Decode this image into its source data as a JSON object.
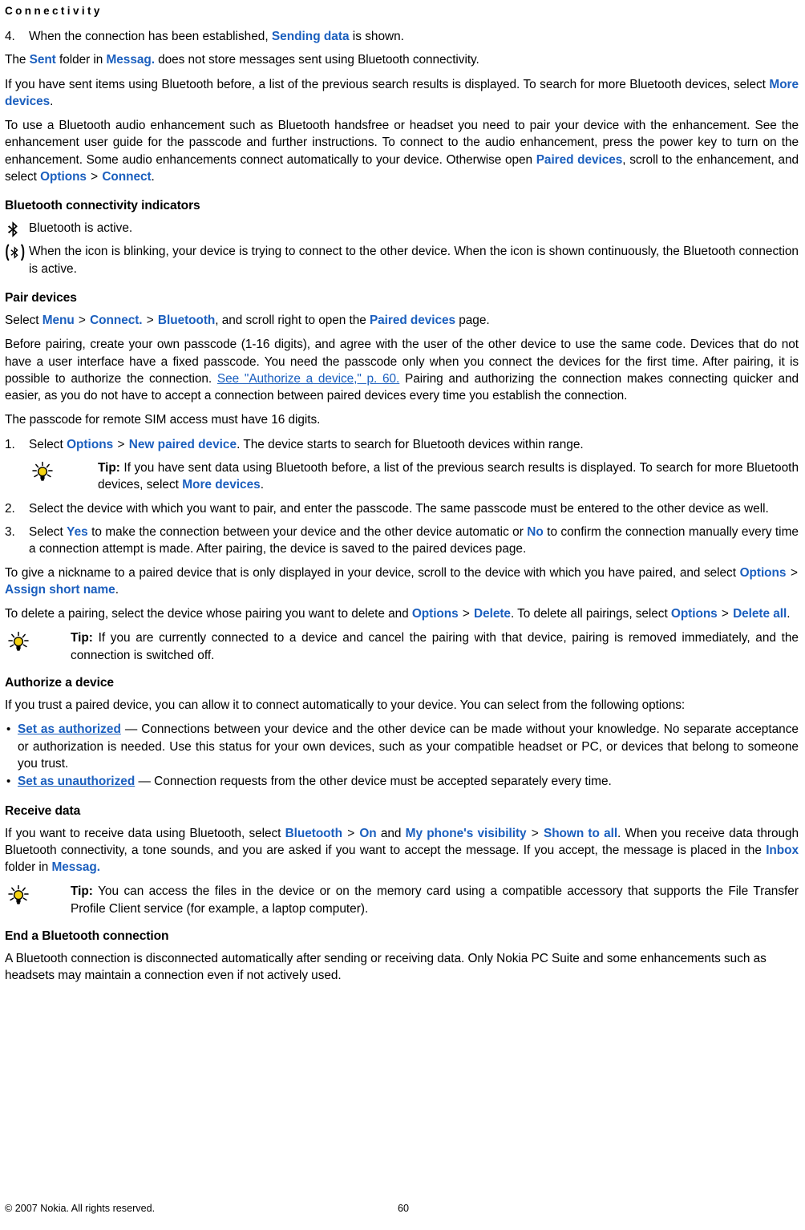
{
  "document": {
    "running_header": "Connectivity",
    "page_number": "60",
    "copyright": "© 2007 Nokia. All rights reserved."
  },
  "colors": {
    "link_blue": "#1B5FBE",
    "text_black": "#000000",
    "bulb_yellow": "#F5D312",
    "page_background": "#FFFFFF"
  },
  "intro": {
    "step4": {
      "number": "4.",
      "before": "When the connection has been established, ",
      "ui_1": "Sending data",
      "after": " is shown."
    },
    "sent_folder": {
      "before": "The ",
      "ui_1": "Sent",
      "mid_1": " folder in ",
      "ui_2": "Messag.",
      "after": " does not store messages sent using Bluetooth connectivity."
    },
    "sent_items": {
      "before": "If you have sent items using Bluetooth before, a list of the previous search results is displayed. To search for more Bluetooth devices, select ",
      "ui_1": "More devices",
      "after": "."
    },
    "audio_enhancement": {
      "before": "To use a Bluetooth audio enhancement such as Bluetooth handsfree or headset you need to pair your device with the enhancement. See the enhancement user guide for the passcode and further instructions. To connect to the audio enhancement, press the power key to turn on the enhancement. Some audio enhancements connect automatically to your device. Otherwise open ",
      "ui_1": "Paired devices",
      "mid_1": ", scroll to the enhancement, and select ",
      "ui_2": "Options",
      "sep_1": " > ",
      "ui_3": "Connect",
      "after": "."
    }
  },
  "indicators": {
    "heading": "Bluetooth connectivity indicators",
    "items": [
      {
        "icon": "bluetooth-icon",
        "text": "Bluetooth is active."
      },
      {
        "icon": "bluetooth-connected-icon",
        "text": "When the icon is blinking, your device is trying to connect to the other device. When the icon is shown continuously, the Bluetooth connection is active."
      }
    ]
  },
  "pair_devices": {
    "heading": "Pair devices",
    "select_path": {
      "before": "Select ",
      "ui_1": "Menu",
      "sep_1": " > ",
      "ui_2": "Connect.",
      "sep_2": " > ",
      "ui_3": "Bluetooth",
      "mid_1": ", and scroll right to open the ",
      "ui_4": "Paired devices",
      "after": " page."
    },
    "before_pairing": {
      "before": "Before pairing, create your own passcode (1-16 digits), and agree with the user of the other device to use the same code. Devices that do not have a user interface have a fixed passcode. You need the passcode only when you connect the devices for the first time. After pairing, it is possible to authorize the connection. ",
      "xref": "See \"Authorize a device,\" p. 60.",
      "after": " Pairing and authorizing the connection makes connecting quicker and easier, as you do not have to accept a connection between paired devices every time you establish the connection."
    },
    "remote_sim": "The passcode for remote SIM access must have 16 digits.",
    "steps": [
      {
        "number": "1.",
        "before": "Select ",
        "ui_1": "Options",
        "sep_1": " > ",
        "ui_2": "New paired device",
        "after": ". The device starts to search for Bluetooth devices within range."
      },
      {
        "number": "2.",
        "before": "Select the device with which you want to pair, and enter the passcode. The same passcode must be entered to the other device as well.",
        "ui_1": "",
        "after": ""
      },
      {
        "number": "3.",
        "before": "Select ",
        "ui_1": "Yes",
        "mid_1": " to make the connection between your device and the other device automatic or ",
        "ui_2": "No",
        "after": " to confirm the connection manually every time a connection attempt is made. After pairing, the device is saved to the paired devices page."
      }
    ],
    "tip_search": {
      "label": "Tip:",
      "before": " If you have sent data using Bluetooth before, a list of the previous search results is displayed. To search for more Bluetooth devices, select ",
      "ui_1": "More devices",
      "after": "."
    },
    "nickname": {
      "before": "To give a nickname to a paired device that is only displayed in your device, scroll to the device with which you have paired, and select ",
      "ui_1": "Options",
      "sep_1": " > ",
      "ui_2": "Assign short name",
      "after": "."
    },
    "delete_pairing": {
      "before": "To delete a pairing, select the device whose pairing you want to delete and ",
      "ui_1": "Options",
      "sep_1": " > ",
      "ui_2": "Delete",
      "mid_1": ". To delete all pairings, select ",
      "ui_3": "Options",
      "sep_2": " > ",
      "ui_4": "Delete all",
      "after": "."
    },
    "tip_cancel": {
      "label": "Tip:",
      "text": " If you are currently connected to a device and cancel the pairing with that device, pairing is removed immediately, and the connection is switched off."
    }
  },
  "authorize_device": {
    "heading": "Authorize a device",
    "intro": "If you trust a paired device, you can allow it to connect automatically to your device. You can select from the following options:",
    "bullet_char": "•",
    "options": [
      {
        "ui_1": "Set as authorized",
        "after": " — Connections between your device and the other device can be made without your knowledge. No separate acceptance or authorization is needed. Use this status for your own devices, such as your compatible headset or PC, or devices that belong to someone you trust."
      },
      {
        "ui_1": "Set as unauthorized",
        "after": " — Connection requests from the other device must be accepted separately every time."
      }
    ]
  },
  "receive_data": {
    "heading": "Receive data",
    "body": {
      "before": "If you want to receive data using Bluetooth, select ",
      "ui_1": "Bluetooth",
      "sep_1": " > ",
      "ui_2": "On",
      "mid_1": " and ",
      "ui_3": "My phone's visibility",
      "sep_2": " > ",
      "ui_4": "Shown to all",
      "mid_2": ". When you receive data through Bluetooth connectivity, a tone sounds, and you are asked if you want to accept the message. If you accept, the message is placed in the ",
      "ui_5": "Inbox",
      "mid_3": " folder in ",
      "ui_6": "Messag.",
      "after": ""
    },
    "tip_files": {
      "label": "Tip:",
      "text": " You can access the files in the device or on the memory card using a compatible accessory that supports the File Transfer Profile Client service (for example, a laptop computer)."
    }
  },
  "end_connection": {
    "heading": "End a Bluetooth connection",
    "body": "A Bluetooth connection is disconnected automatically after sending or receiving data. Only Nokia PC Suite and some enhancements such as headsets may maintain a connection even if not actively used."
  }
}
